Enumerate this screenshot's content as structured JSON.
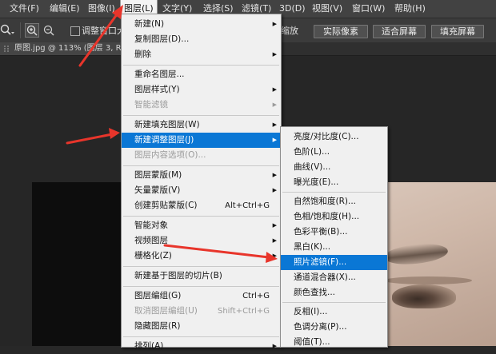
{
  "menubar": [
    {
      "label": "文件(F)",
      "active": false
    },
    {
      "label": "编辑(E)",
      "active": false
    },
    {
      "label": "图像(I)",
      "active": false
    },
    {
      "label": "图层(L)",
      "active": true
    },
    {
      "label": "文字(Y)",
      "active": false
    },
    {
      "label": "选择(S)",
      "active": false
    },
    {
      "label": "滤镜(T)",
      "active": false
    },
    {
      "label": "3D(D)",
      "active": false
    },
    {
      "label": "视图(V)",
      "active": false
    },
    {
      "label": "窗口(W)",
      "active": false
    },
    {
      "label": "帮助(H)",
      "active": false
    }
  ],
  "options_bar": {
    "resize_window_label": "调整窗口大小",
    "zoom_all_label": "缩放",
    "buttons": [
      "实际像素",
      "适合屏幕",
      "填充屏幕"
    ]
  },
  "document_tab": {
    "title": "原图.jpg @ 113% (图层 3, R"
  },
  "layer_menu": [
    {
      "label": "新建(N)",
      "submenu": true
    },
    {
      "label": "复制图层(D)..."
    },
    {
      "label": "删除",
      "submenu": true
    },
    {
      "separator": true
    },
    {
      "label": "重命名图层..."
    },
    {
      "label": "图层样式(Y)",
      "submenu": true
    },
    {
      "label": "智能滤镜",
      "submenu": true,
      "disabled": true
    },
    {
      "separator": true
    },
    {
      "label": "新建填充图层(W)",
      "submenu": true
    },
    {
      "label": "新建调整图层(J)",
      "submenu": true,
      "highlighted": true
    },
    {
      "label": "图层内容选项(O)...",
      "disabled": true
    },
    {
      "separator": true
    },
    {
      "label": "图层蒙版(M)",
      "submenu": true
    },
    {
      "label": "矢量蒙版(V)",
      "submenu": true
    },
    {
      "label": "创建剪贴蒙版(C)",
      "shortcut": "Alt+Ctrl+G"
    },
    {
      "separator": true
    },
    {
      "label": "智能对象",
      "submenu": true
    },
    {
      "label": "视频图层",
      "submenu": true
    },
    {
      "label": "栅格化(Z)",
      "submenu": true
    },
    {
      "separator": true
    },
    {
      "label": "新建基于图层的切片(B)"
    },
    {
      "separator": true
    },
    {
      "label": "图层编组(G)",
      "shortcut": "Ctrl+G"
    },
    {
      "label": "取消图层编组(U)",
      "shortcut": "Shift+Ctrl+G",
      "disabled": true
    },
    {
      "label": "隐藏图层(R)"
    },
    {
      "separator": true
    },
    {
      "label": "排列(A)",
      "submenu": true
    }
  ],
  "adjustment_submenu": [
    {
      "label": "亮度/对比度(C)..."
    },
    {
      "label": "色阶(L)..."
    },
    {
      "label": "曲线(V)..."
    },
    {
      "label": "曝光度(E)..."
    },
    {
      "separator": true
    },
    {
      "label": "自然饱和度(R)..."
    },
    {
      "label": "色相/饱和度(H)..."
    },
    {
      "label": "色彩平衡(B)..."
    },
    {
      "label": "黑白(K)..."
    },
    {
      "label": "照片滤镜(F)...",
      "highlighted": true
    },
    {
      "label": "通道混合器(X)..."
    },
    {
      "label": "颜色查找..."
    },
    {
      "separator": true
    },
    {
      "label": "反相(I)..."
    },
    {
      "label": "色调分离(P)..."
    },
    {
      "label": "阈值(T)..."
    }
  ],
  "colors": {
    "highlight": "#0a77d5",
    "annotation_arrow": "#e8352b"
  }
}
